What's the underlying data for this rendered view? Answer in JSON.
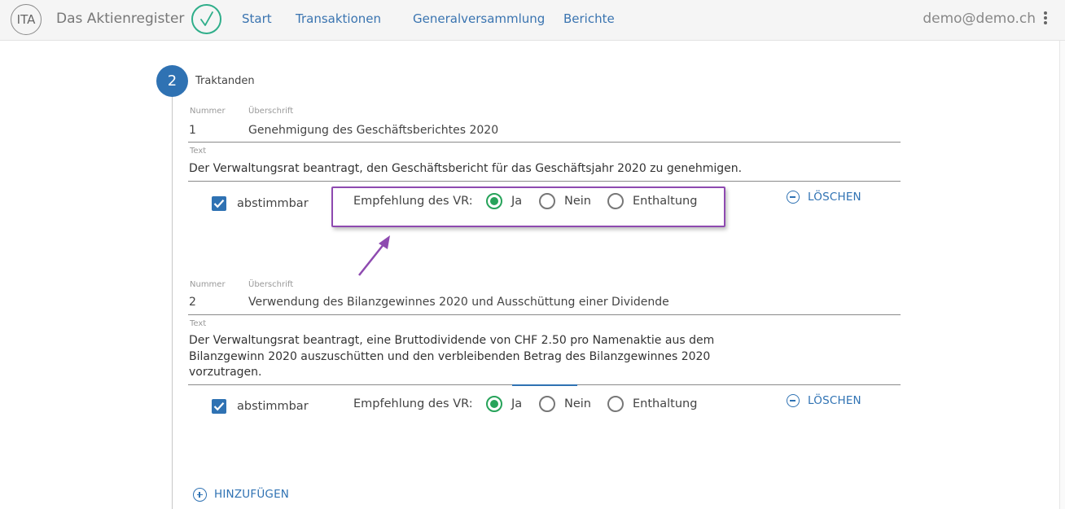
{
  "header": {
    "logo_text": "ITA",
    "app_title": "Das Aktienregister",
    "nav": [
      "Start",
      "Transaktionen",
      "Generalversammlung",
      "Berichte"
    ],
    "user_email": "demo@demo.ch"
  },
  "step": {
    "number": "2",
    "title": "Traktanden"
  },
  "labels": {
    "nummer": "Nummer",
    "ueberschrift": "Überschrift",
    "text": "Text",
    "abstimmbar": "abstimmbar",
    "empfehlung": "Empfehlung des VR:",
    "ja": "Ja",
    "nein": "Nein",
    "enthaltung": "Enthaltung",
    "loeschen": "LÖSCHEN",
    "hinzufuegen": "HINZUFÜGEN"
  },
  "items": [
    {
      "nummer": "1",
      "ueberschrift": "Genehmigung des Geschäftsberichtes 2020",
      "text_lines": [
        "Der Verwaltungsrat beantragt, den Geschäftsbericht für das Geschäftsjahr 2020 zu genehmigen."
      ],
      "abstimmbar": true,
      "empfehlung": "Ja"
    },
    {
      "nummer": "2",
      "ueberschrift": "Verwendung des Bilanzgewinnes 2020 und Ausschüttung einer Dividende",
      "text_lines": [
        "Der Verwaltungsrat beantragt, eine Bruttodividende von CHF 2.50 pro Namenaktie aus dem",
        "Bilanzgewinn 2020 auszuschütten und den verbleibenden Betrag des Bilanzgewinnes 2020",
        "vorzutragen."
      ],
      "abstimmbar": true,
      "empfehlung": "Ja"
    }
  ],
  "colors": {
    "accent": "#2f72b3",
    "success": "#27a35a",
    "annotation": "#8e4ab0"
  }
}
